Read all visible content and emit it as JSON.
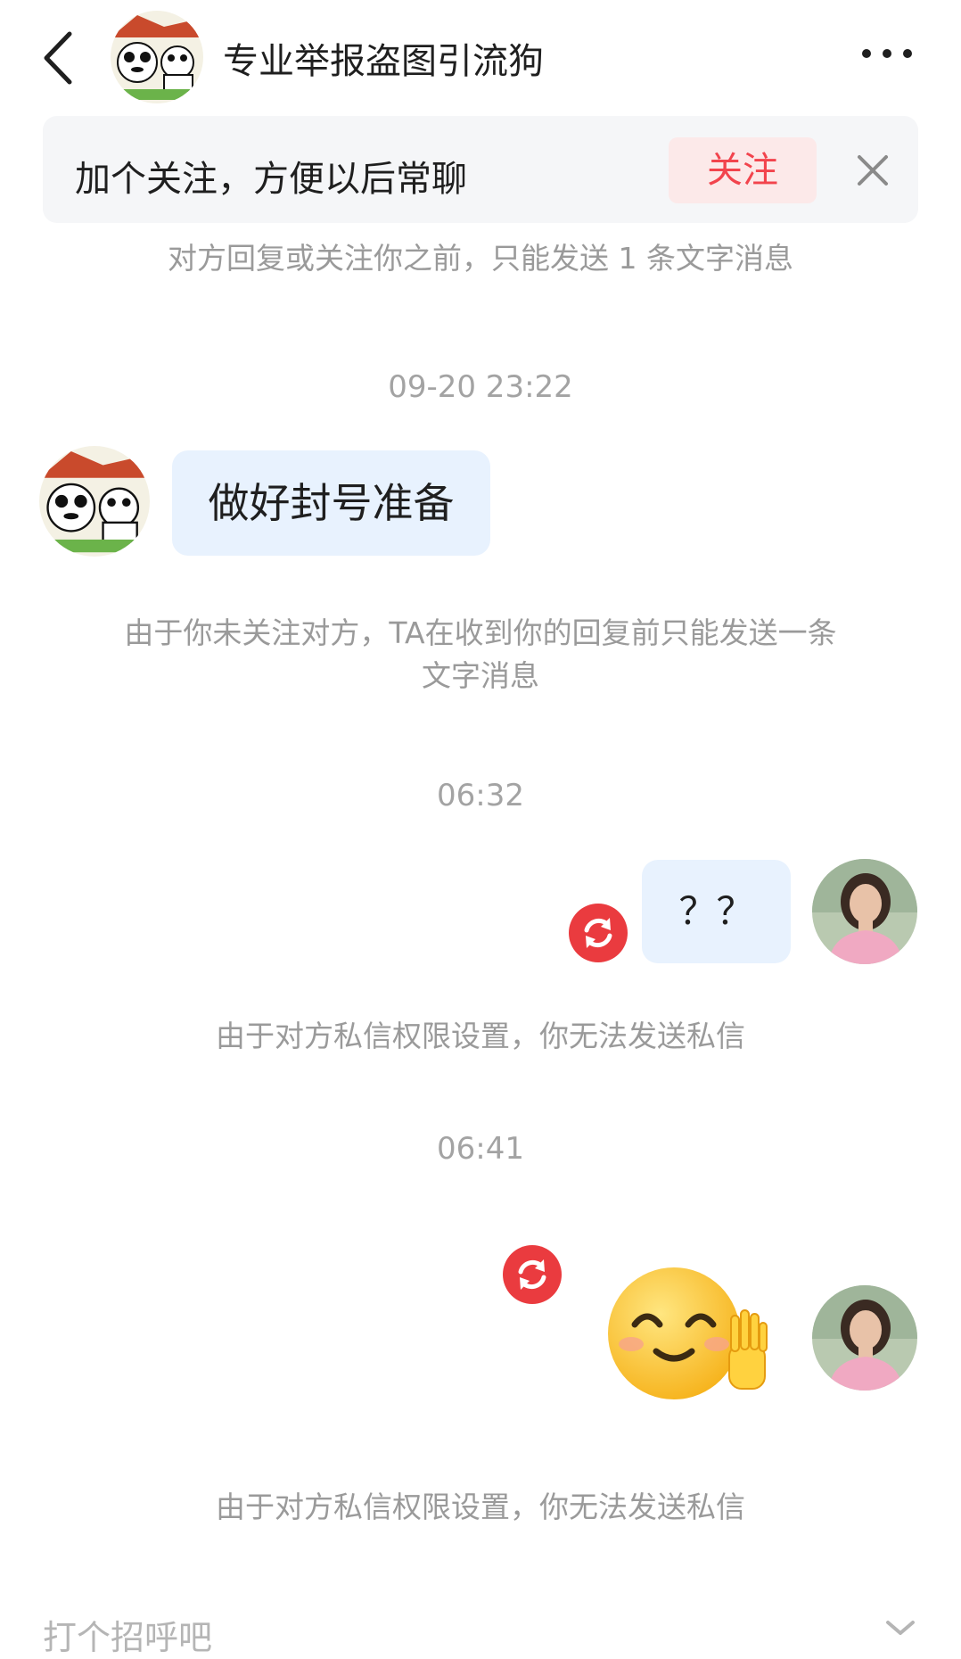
{
  "header": {
    "title": "专业举报盗图引流狗",
    "back_icon": "chevron-left-icon",
    "more_icon": "more-horizontal-icon"
  },
  "banner": {
    "text": "加个关注，方便以后常聊",
    "follow_label": "关注",
    "close_icon": "close-icon",
    "accent": "#f2444d"
  },
  "notices": {
    "before_follow": "对方回复或关注你之前，只能发送 1 条文字消息",
    "not_following_line1": "由于你未关注对方，TA在收到你的回复前只能发送一条",
    "not_following_line2": "文字消息",
    "permission_1": "由于对方私信权限设置，你无法发送私信",
    "permission_2": "由于对方私信权限设置，你无法发送私信"
  },
  "messages": [
    {
      "time": "09-20 23:22",
      "from": "other",
      "text": "做好封号准备"
    },
    {
      "time": "06:32",
      "from": "me",
      "text": "？？",
      "status": "failed"
    },
    {
      "time": "06:41",
      "from": "me",
      "text": "",
      "emoji": "smile-wave-emoji",
      "status": "failed"
    }
  ],
  "input": {
    "placeholder": "打个招呼吧"
  },
  "colors": {
    "bubble": "#e8f2fe",
    "retry": "#ea3b3f",
    "system_text": "#9a9a9a"
  }
}
